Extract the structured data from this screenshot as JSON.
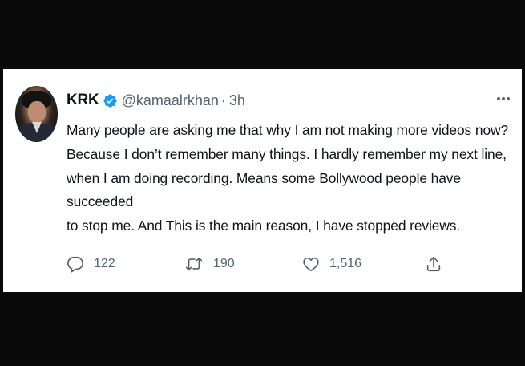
{
  "tweet": {
    "author": {
      "display_name": "KRK",
      "handle": "@kamaalrkhan",
      "verified": true
    },
    "separator": "·",
    "time": "3h",
    "text": "Many people are asking me that why I am not making more videos now?\nBecause I don’t remember many things. I hardly remember my next line,\nwhen I am doing recording. Means some Bollywood people have succeeded\nto stop me. And This is the main reason, I have stopped reviews.",
    "actions": {
      "reply": {
        "icon": "reply-icon",
        "count": "122"
      },
      "retweet": {
        "icon": "retweet-icon",
        "count": "190"
      },
      "like": {
        "icon": "like-icon",
        "count": "1,516"
      },
      "share": {
        "icon": "share-icon"
      }
    },
    "more_icon": "more-options-icon"
  },
  "colors": {
    "background": "#0a0a0a",
    "card": "#ffffff",
    "text": "#0f1419",
    "secondary": "#536471",
    "verified": "#1d9bf0"
  }
}
